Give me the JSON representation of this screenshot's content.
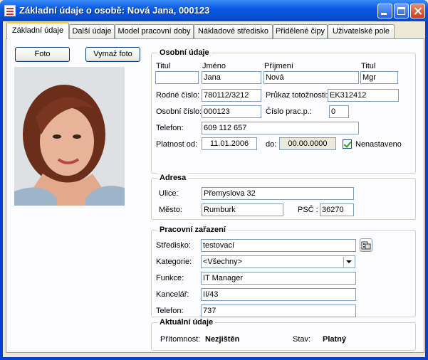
{
  "window": {
    "title": "Základní údaje o osobě: Nová Jana, 000123"
  },
  "tabs": [
    {
      "label": "Základní údaje"
    },
    {
      "label": "Další údaje"
    },
    {
      "label": "Model pracovní doby"
    },
    {
      "label": "Nákladové středisko"
    },
    {
      "label": "Přidělené čipy"
    },
    {
      "label": "Uživatelské pole"
    }
  ],
  "photo": {
    "foto_label": "Foto",
    "delete_label": "Vymaž foto"
  },
  "personal": {
    "title": "Osobní údaje",
    "titul_label": "Titul",
    "jmeno_label": "Jméno",
    "prijmeni_label": "Příjmení",
    "titul2_label": "Titul",
    "titul": "",
    "jmeno": "Jana",
    "prijmeni": "Nová",
    "titul2": "Mgr",
    "rodne_cislo_label": "Rodné číslo:",
    "rodne_cislo": "780112/3212",
    "prukaz_label": "Průkaz totožnosti:",
    "prukaz": "EK312412",
    "osobni_cislo_label": "Osobní číslo:",
    "osobni_cislo": "000123",
    "cislo_prac_label": "Číslo prac.p.:",
    "cislo_prac": "0",
    "telefon_label": "Telefon:",
    "telefon": "609 112 657",
    "platnost_label": "Platnost od:",
    "platnost_od": "11.01.2006",
    "do_label": "do:",
    "platnost_do": "00.00.0000",
    "nenastaveno_label": "Nenastaveno"
  },
  "address": {
    "title": "Adresa",
    "ulice_label": "Ulice:",
    "ulice": "Přemyslova 32",
    "mesto_label": "Město:",
    "mesto": "Rumburk",
    "psc_label": "PSČ :",
    "psc": "36270"
  },
  "work": {
    "title": "Pracovní zařazení",
    "stredisko_label": "Středisko:",
    "stredisko": "testovací",
    "kategorie_label": "Kategorie:",
    "kategorie": "<Všechny>",
    "funkce_label": "Funkce:",
    "funkce": "IT Manager",
    "kancelar_label": "Kancelář:",
    "kancelar": "II/43",
    "telefon_label": "Telefon:",
    "telefon": "737"
  },
  "current": {
    "title": "Aktuální údaje",
    "pritomnost_label": "Přítomnost:",
    "pritomnost": "Nezjištěn",
    "stav_label": "Stav:",
    "stav": "Platný"
  },
  "colors": {
    "titlebar": "#0a5ae6",
    "tab_highlight": "#ffc83c",
    "group_border": "#d0d0bf"
  }
}
